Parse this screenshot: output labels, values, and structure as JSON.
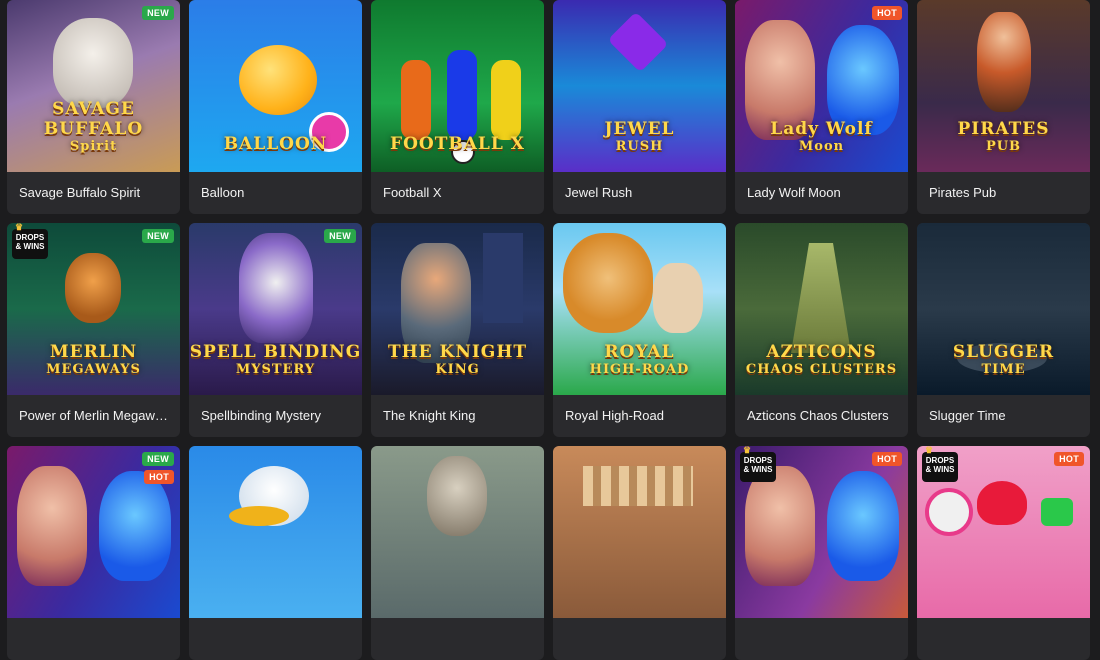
{
  "games": [
    {
      "title": "Savage Buffalo Spirit",
      "badges": [
        "NEW"
      ],
      "drops": false,
      "logo": "SAVAGE BUFFALO",
      "logo2": "Spirit",
      "bg": "linear-gradient(160deg,#4b3a6e,#9a7bb0 45%,#c99b55)",
      "icon": "buffalo-icon"
    },
    {
      "title": "Balloon",
      "badges": [],
      "drops": false,
      "logo": "BALLOON",
      "logo2": "",
      "bg": "linear-gradient(180deg,#2b7de8,#1ea8f0)",
      "icon": "balloon-icon"
    },
    {
      "title": "Football X",
      "badges": [],
      "drops": false,
      "logo": "FOOTBALL X",
      "logo2": "",
      "bg": "linear-gradient(180deg,#0f7a2f,#1fa84a 60%,#0e5e25)",
      "icon": "football-icon"
    },
    {
      "title": "Jewel Rush",
      "badges": [],
      "drops": false,
      "logo": "JEWEL",
      "logo2": "RUSH",
      "bg": "linear-gradient(180deg,#3a2ab0,#1a8ad8 50%,#5a2ec8)",
      "icon": "jewel-icon"
    },
    {
      "title": "Lady Wolf Moon",
      "badges": [
        "HOT"
      ],
      "drops": false,
      "logo": "Lady Wolf",
      "logo2": "Moon",
      "bg": "linear-gradient(120deg,#7a1a6a,#3a2aa0 55%,#1a4ad0)",
      "icon": "wolf-icon"
    },
    {
      "title": "Pirates Pub",
      "badges": [],
      "drops": false,
      "logo": "PIRATES",
      "logo2": "PUB",
      "bg": "linear-gradient(180deg,#5a3a2a,#3a2a4a 60%,#6a2a5a)",
      "icon": "pirate-icon"
    },
    {
      "title": "Power of Merlin Megawa...",
      "badges": [
        "NEW"
      ],
      "drops": true,
      "logo": "MERLIN",
      "logo2": "MEGAWAYS",
      "bg": "linear-gradient(180deg,#0e4a3a,#1a6a4a 50%,#3a2a6a)",
      "icon": "owl-icon"
    },
    {
      "title": "Spellbinding Mystery",
      "badges": [
        "NEW"
      ],
      "drops": false,
      "logo": "SPELL BINDING",
      "logo2": "MYSTERY",
      "bg": "linear-gradient(180deg,#2a3a6a,#4a3a8a 50%,#2a1a4a)",
      "icon": "wizard-icon"
    },
    {
      "title": "The Knight King",
      "badges": [],
      "drops": false,
      "logo": "THE KNIGHT",
      "logo2": "KING",
      "bg": "linear-gradient(180deg,#1a2a4a,#2a3a6a 50%,#1a1a2a)",
      "icon": "knight-icon"
    },
    {
      "title": "Royal High-Road",
      "badges": [],
      "drops": false,
      "logo": "ROYAL",
      "logo2": "HIGH-ROAD",
      "bg": "linear-gradient(180deg,#6ac8f0,#a8e0f8 40%,#2aa84a)",
      "icon": "horse-icon"
    },
    {
      "title": "Azticons Chaos Clusters",
      "badges": [],
      "drops": false,
      "logo": "AZTICONS",
      "logo2": "CHAOS CLUSTERS",
      "bg": "linear-gradient(180deg,#2a4a2a,#4a6a3a 50%,#1a3a2a)",
      "icon": "temple-icon"
    },
    {
      "title": "Slugger Time",
      "badges": [],
      "drops": false,
      "logo": "SLUGGER",
      "logo2": "TIME",
      "bg": "linear-gradient(180deg,#1a2a3a,#2a3a4a 50%,#0a1a2a)",
      "icon": "bat-icon"
    },
    {
      "title": "",
      "badges": [
        "NEW",
        "HOT"
      ],
      "drops": false,
      "logo": "",
      "logo2": "",
      "bg": "linear-gradient(120deg,#7a1a6a,#3a2aa0 55%,#1a4ad0)",
      "icon": "wolf-icon"
    },
    {
      "title": "",
      "badges": [],
      "drops": false,
      "logo": "",
      "logo2": "",
      "bg": "linear-gradient(180deg,#2a8ae8,#4ab0f0)",
      "icon": "pelican-icon"
    },
    {
      "title": "",
      "badges": [],
      "drops": false,
      "logo": "",
      "logo2": "",
      "bg": "linear-gradient(180deg,#8a9a8a,#5a6a6a)",
      "icon": "viking-icon"
    },
    {
      "title": "",
      "badges": [],
      "drops": false,
      "logo": "",
      "logo2": "",
      "bg": "linear-gradient(180deg,#c88a5a,#8a5a3a)",
      "icon": "ruins-icon"
    },
    {
      "title": "",
      "badges": [
        "HOT"
      ],
      "drops": true,
      "logo": "",
      "logo2": "",
      "bg": "linear-gradient(120deg,#3a1a6a,#8a3aa0 60%,#c85a3a)",
      "icon": "wolf-icon"
    },
    {
      "title": "",
      "badges": [
        "HOT"
      ],
      "drops": true,
      "logo": "",
      "logo2": "",
      "bg": "linear-gradient(180deg,#f0a0c8,#e86aa8)",
      "icon": "candy-icon"
    }
  ],
  "drops_label_1": "DROPS",
  "drops_label_2": "& WINS"
}
